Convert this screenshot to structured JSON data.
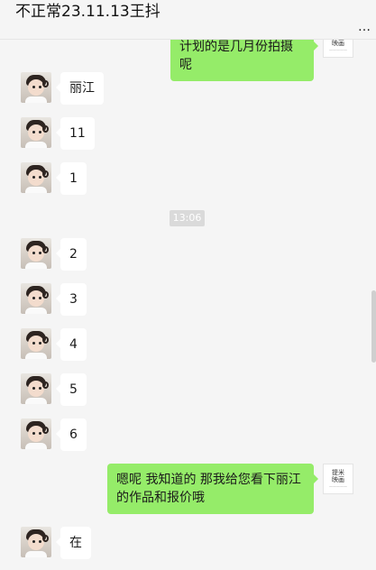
{
  "header": {
    "title": "不正常23.11.13王抖",
    "more_icon": "more-horizontal-icon",
    "more_glyph": "…"
  },
  "colors": {
    "self_bubble": "#95ec69",
    "other_bubble": "#ffffff",
    "background": "#f5f5f5"
  },
  "shop_avatar": {
    "line1": "提米",
    "line2": "映画",
    "line3": "—————"
  },
  "messages": [
    {
      "from": "self",
      "text": "计划的是几月份拍摄呢"
    },
    {
      "from": "other",
      "text": "丽江"
    },
    {
      "from": "other",
      "text": "11"
    },
    {
      "from": "other",
      "text": "1"
    },
    {
      "from": "time",
      "text": "13:06"
    },
    {
      "from": "other",
      "text": "2"
    },
    {
      "from": "other",
      "text": "3"
    },
    {
      "from": "other",
      "text": "4"
    },
    {
      "from": "other",
      "text": "5"
    },
    {
      "from": "other",
      "text": "6"
    },
    {
      "from": "self",
      "text": "嗯呢 我知道的  那我给您看下丽江的作品和报价哦"
    },
    {
      "from": "other",
      "text": "在"
    }
  ]
}
